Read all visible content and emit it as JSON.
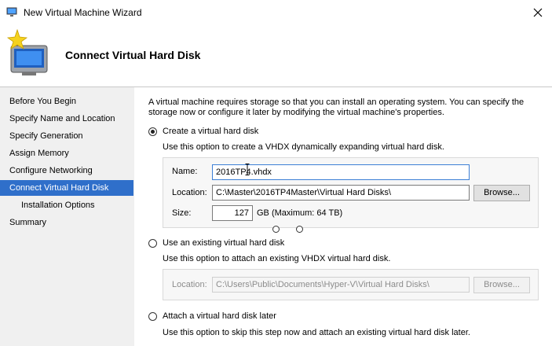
{
  "window": {
    "title": "New Virtual Machine Wizard"
  },
  "header": {
    "title": "Connect Virtual Hard Disk"
  },
  "sidebar": {
    "items": [
      {
        "label": "Before You Begin"
      },
      {
        "label": "Specify Name and Location"
      },
      {
        "label": "Specify Generation"
      },
      {
        "label": "Assign Memory"
      },
      {
        "label": "Configure Networking"
      },
      {
        "label": "Connect Virtual Hard Disk"
      },
      {
        "label": "Installation Options"
      },
      {
        "label": "Summary"
      }
    ],
    "active_index": 5
  },
  "intro_text": "A virtual machine requires storage so that you can install an operating system. You can specify the storage now or configure it later by modifying the virtual machine's properties.",
  "options": {
    "create": {
      "label": "Create a virtual hard disk",
      "selected": true,
      "description": "Use this option to create a VHDX dynamically expanding virtual hard disk.",
      "name_label": "Name:",
      "name_value": "2016TP4.vhdx",
      "location_label": "Location:",
      "location_value": "C:\\Master\\2016TP4Master\\Virtual Hard Disks\\",
      "browse_label": "Browse...",
      "size_label": "Size:",
      "size_value": "127",
      "size_suffix": "GB (Maximum: 64 TB)"
    },
    "existing": {
      "label": "Use an existing virtual hard disk",
      "selected": false,
      "description": "Use this option to attach an existing VHDX virtual hard disk.",
      "location_label": "Location:",
      "location_value": "C:\\Users\\Public\\Documents\\Hyper-V\\Virtual Hard Disks\\",
      "browse_label": "Browse..."
    },
    "later": {
      "label": "Attach a virtual hard disk later",
      "selected": false,
      "description": "Use this option to skip this step now and attach an existing virtual hard disk later."
    }
  },
  "icons": {
    "app": "virtual-machine-icon",
    "hero": "virtual-machine-wizard-icon",
    "close": "close-icon"
  },
  "colors": {
    "active_nav": "#2f6fca",
    "sidebar_bg": "#f0f0f0",
    "focus_border": "#3c7fd6"
  }
}
